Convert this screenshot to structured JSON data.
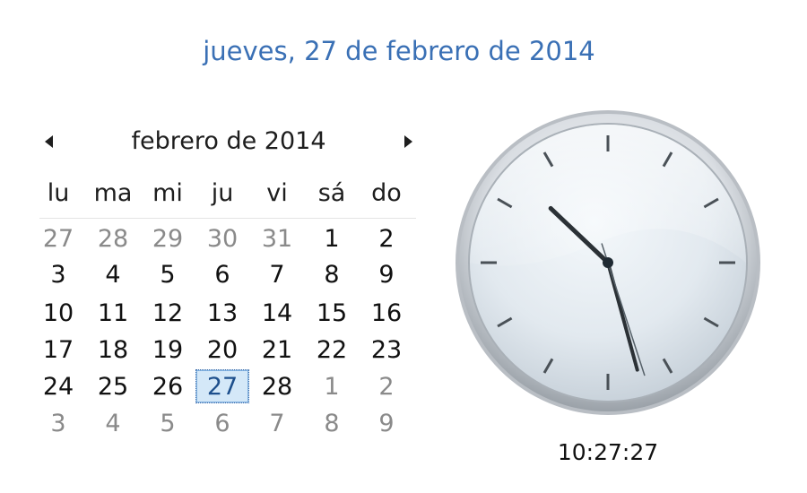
{
  "header": {
    "full_date": "jueves, 27 de febrero de 2014"
  },
  "calendar": {
    "month_title": "febrero de 2014",
    "prev_icon": "triangle-left-icon",
    "next_icon": "triangle-right-icon",
    "weekdays": [
      "lu",
      "ma",
      "mi",
      "ju",
      "vi",
      "sá",
      "do"
    ],
    "weeks": [
      [
        {
          "d": "27",
          "out": true
        },
        {
          "d": "28",
          "out": true
        },
        {
          "d": "29",
          "out": true
        },
        {
          "d": "30",
          "out": true
        },
        {
          "d": "31",
          "out": true
        },
        {
          "d": "1"
        },
        {
          "d": "2"
        }
      ],
      [
        {
          "d": "3"
        },
        {
          "d": "4"
        },
        {
          "d": "5"
        },
        {
          "d": "6"
        },
        {
          "d": "7"
        },
        {
          "d": "8"
        },
        {
          "d": "9"
        }
      ],
      [
        {
          "d": "10"
        },
        {
          "d": "11"
        },
        {
          "d": "12"
        },
        {
          "d": "13"
        },
        {
          "d": "14"
        },
        {
          "d": "15"
        },
        {
          "d": "16"
        }
      ],
      [
        {
          "d": "17"
        },
        {
          "d": "18"
        },
        {
          "d": "19"
        },
        {
          "d": "20"
        },
        {
          "d": "21"
        },
        {
          "d": "22"
        },
        {
          "d": "23"
        }
      ],
      [
        {
          "d": "24"
        },
        {
          "d": "25"
        },
        {
          "d": "26"
        },
        {
          "d": "27",
          "today": true
        },
        {
          "d": "28"
        },
        {
          "d": "1",
          "out": true
        },
        {
          "d": "2",
          "out": true
        }
      ],
      [
        {
          "d": "3",
          "out": true
        },
        {
          "d": "4",
          "out": true
        },
        {
          "d": "5",
          "out": true
        },
        {
          "d": "6",
          "out": true
        },
        {
          "d": "7",
          "out": true
        },
        {
          "d": "8",
          "out": true
        },
        {
          "d": "9",
          "out": true
        }
      ]
    ],
    "today_color": "#d4e8f8"
  },
  "clock": {
    "time": "10:27:27",
    "hour": 10,
    "minute": 27,
    "second": 27,
    "face_icon": "analog-clock-icon"
  },
  "colors": {
    "date_link": "#3a70b5"
  }
}
